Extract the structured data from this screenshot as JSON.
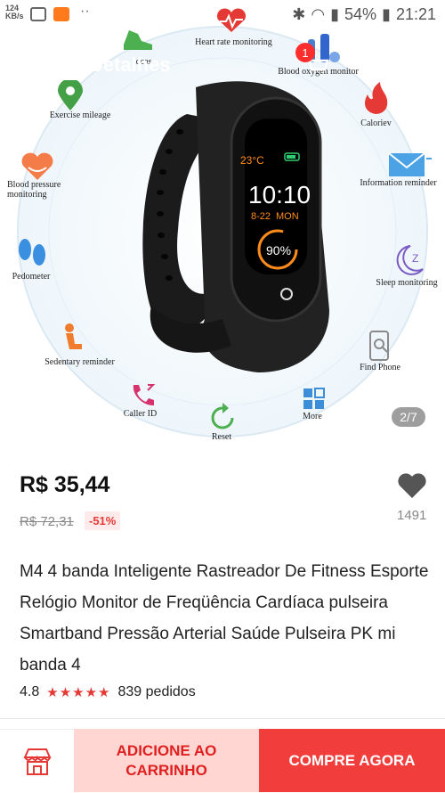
{
  "status_bar": {
    "speed": "124",
    "speed_unit": "KB/s",
    "battery": "54%",
    "time": "21:21"
  },
  "topbar": {
    "title": "Detalhes",
    "cart_count": "1"
  },
  "gallery": {
    "page_indicator": "2/7",
    "watch": {
      "temp": "23°C",
      "time": "10:10",
      "date": "8-22",
      "day": "MON",
      "percent": "90%"
    },
    "features": [
      {
        "label": "Heart rate monitoring",
        "icon": "heart-rate-icon"
      },
      {
        "label": "Blood oxygen monitor",
        "icon": "blood-oxygen-icon"
      },
      {
        "label": "Exercise mileage",
        "icon": "map-pin-icon"
      },
      {
        "label": "Caloriev",
        "icon": "flame-icon"
      },
      {
        "label": "Blood pressure monitoring",
        "icon": "blood-pressure-icon"
      },
      {
        "label": "Information reminder",
        "icon": "envelope-icon"
      },
      {
        "label": "Pedometer",
        "icon": "footprints-icon"
      },
      {
        "label": "Sleep monitoring",
        "icon": "sleep-icon"
      },
      {
        "label": "Sedentary reminder",
        "icon": "sitting-person-icon"
      },
      {
        "label": "Find Phone",
        "icon": "phone-search-icon"
      },
      {
        "label": "Caller ID",
        "icon": "caller-id-icon"
      },
      {
        "label": "More",
        "icon": "grid-icon"
      },
      {
        "label": "Reset",
        "icon": "reset-icon"
      },
      {
        "label": "Ideas",
        "icon": "shoe-icon"
      }
    ]
  },
  "product": {
    "price": "R$ 35,44",
    "old_price": "R$ 72,31",
    "discount": "-51%",
    "favorites": "1491",
    "title": "M4 4 banda Inteligente Rastreador De Fitness Esporte Relógio Monitor de Freqüência Cardíaca pulseira Smartband Pressão Arterial Saúde Pulseira PK mi banda 4",
    "rating": "4.8",
    "stars": "★★★★★",
    "orders": "839 pedidos"
  },
  "bottom_bar": {
    "add_to_cart": "ADICIONE AO CARRINHO",
    "buy_now": "COMPRE AGORA"
  },
  "colors": {
    "accent": "#f23d3d",
    "cart_bg": "#ffd6d2",
    "rating_star": "#e53935"
  }
}
